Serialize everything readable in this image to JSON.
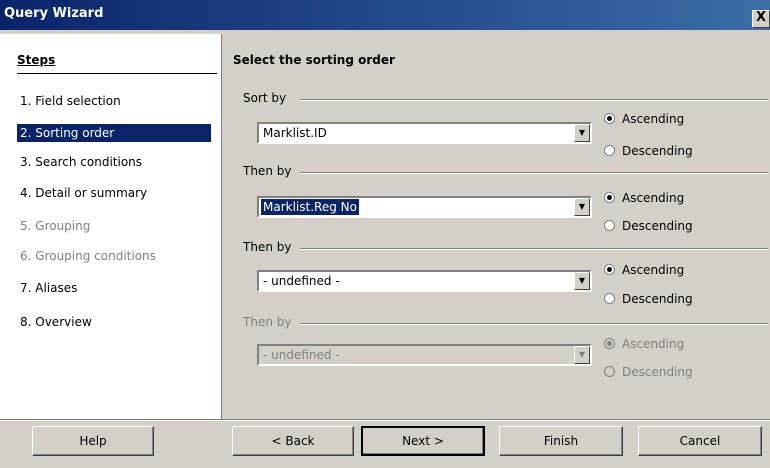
{
  "window": {
    "title": "Query Wizard",
    "close_glyph": "X"
  },
  "steps": {
    "title": "Steps",
    "items": [
      {
        "label": "1. Field selection",
        "state": "normal"
      },
      {
        "label": "2. Sorting order",
        "state": "active"
      },
      {
        "label": "3. Search conditions",
        "state": "normal"
      },
      {
        "label": "4. Detail or summary",
        "state": "normal"
      },
      {
        "label": "5. Grouping",
        "state": "disabled"
      },
      {
        "label": "6. Grouping conditions",
        "state": "disabled"
      },
      {
        "label": "7. Aliases",
        "state": "normal"
      },
      {
        "label": "8. Overview",
        "state": "normal"
      }
    ]
  },
  "main": {
    "title": "Select the sorting order",
    "groups": [
      {
        "label": "Sort by",
        "value": "Marklist.ID",
        "ascending_label": "Ascending",
        "descending_label": "Descending",
        "order": "ascending",
        "enabled": true
      },
      {
        "label": "Then by",
        "value": "Marklist.Reg No",
        "ascending_label": "Ascending",
        "descending_label": "Descending",
        "order": "ascending",
        "enabled": true
      },
      {
        "label": "Then by",
        "value": "- undefined -",
        "ascending_label": "Ascending",
        "descending_label": "Descending",
        "order": "ascending",
        "enabled": true
      },
      {
        "label": "Then by",
        "value": "- undefined -",
        "ascending_label": "Ascending",
        "descending_label": "Descending",
        "order": "ascending",
        "enabled": false
      }
    ]
  },
  "buttons": {
    "help": "Help",
    "back": "< Back",
    "next": "Next >",
    "finish": "Finish",
    "cancel": "Cancel"
  }
}
